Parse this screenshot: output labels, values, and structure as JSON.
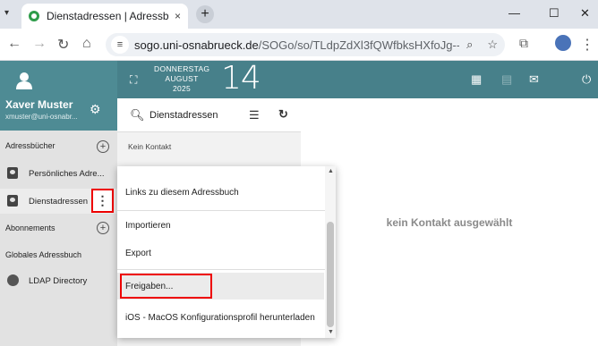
{
  "browser": {
    "tab_title": "Dienstadressen | Adressbuch | SOGo",
    "tab_close": "×",
    "new_tab": "+",
    "url_host": "sogo.uni-osnabrueck.de",
    "url_path": "/SOGo/so/TLdpZdXl3fQWfbksHXfoJg--/Conta..."
  },
  "app": {
    "user_name": "Xaver Muster",
    "user_mail": "xmuster@uni-osnabr...",
    "date_weekday": "DONNERSTAG",
    "date_month": "AUGUST",
    "date_year": "2025",
    "date_day": "14"
  },
  "sidebar": {
    "section_addressbooks": "Adressbücher",
    "item_personal": "Persönliches Adre...",
    "item_dienst": "Dienstadressen",
    "section_subscriptions": "Abonnements",
    "section_global": "Globales Adressbuch",
    "item_ldap": "LDAP Directory"
  },
  "list": {
    "search_label": "Dienstadressen",
    "empty_text": "Kein Kontakt"
  },
  "detail": {
    "empty_text": "kein Kontakt ausgewählt"
  },
  "menu": {
    "items": [
      "Links zu diesem Adressbuch",
      "Importieren",
      "Export",
      "Freigaben...",
      "iOS - MacOS Konfigurationsprofil herunterladen"
    ]
  },
  "colors": {
    "header": "#47808a",
    "highlight_box": "#ee0000"
  }
}
